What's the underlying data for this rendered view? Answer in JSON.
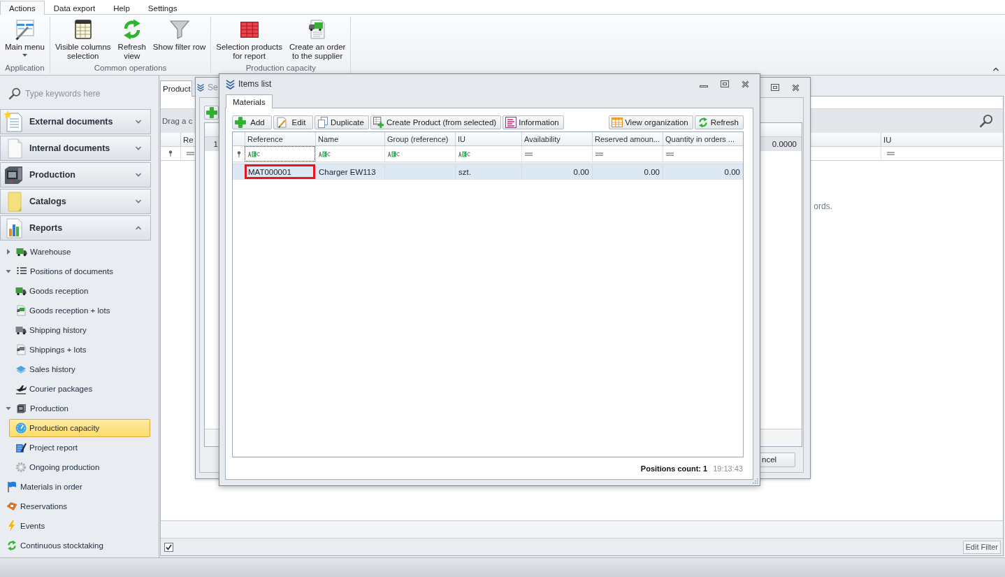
{
  "ribbon": {
    "tabs": [
      {
        "label": "Actions",
        "selected": true
      },
      {
        "label": "Data export",
        "selected": false
      },
      {
        "label": "Help",
        "selected": false
      },
      {
        "label": "Settings",
        "selected": false
      }
    ],
    "groups": [
      {
        "label": "Application",
        "buttons": [
          {
            "label": "Main menu",
            "dropdown": true
          }
        ]
      },
      {
        "label": "Common operations",
        "buttons": [
          {
            "label": "Visible columns\nselection",
            "dropdown": false
          },
          {
            "label": "Refresh\nview",
            "dropdown": false
          },
          {
            "label": "Show filter row",
            "dropdown": false
          }
        ]
      },
      {
        "label": "Production capacity",
        "buttons": [
          {
            "label": "Selection products\nfor report",
            "dropdown": false
          },
          {
            "label": "Create an order\nto the supplier",
            "dropdown": false
          }
        ]
      }
    ]
  },
  "sidebar": {
    "search": {
      "placeholder": "Type keywords here"
    },
    "groups": [
      {
        "label": "External documents",
        "expanded": false
      },
      {
        "label": "Internal documents",
        "expanded": false
      },
      {
        "label": "Production",
        "expanded": false
      },
      {
        "label": "Catalogs",
        "expanded": false
      },
      {
        "label": "Reports",
        "expanded": true
      }
    ],
    "tree": [
      {
        "label": "Warehouse",
        "expanded": false,
        "selected": false
      },
      {
        "label": "Positions of documents",
        "expanded": true,
        "selected": false,
        "children": [
          {
            "label": "Goods reception",
            "selected": false
          },
          {
            "label": "Goods reception + lots",
            "selected": false
          },
          {
            "label": "Shipping history",
            "selected": false
          },
          {
            "label": "Shippings + lots",
            "selected": false
          },
          {
            "label": "Sales history",
            "selected": false
          },
          {
            "label": "Courier packages",
            "selected": false
          }
        ]
      },
      {
        "label": "Production",
        "expanded": true,
        "selected": false,
        "children": [
          {
            "label": "Production capacity",
            "selected": true
          },
          {
            "label": "Project report",
            "selected": false
          },
          {
            "label": "Ongoing production",
            "selected": false
          }
        ]
      },
      {
        "label": "Materials in order",
        "selected": false
      },
      {
        "label": "Reservations",
        "selected": false
      },
      {
        "label": "Events",
        "selected": false
      },
      {
        "label": "Continuous stocktaking",
        "selected": false
      }
    ]
  },
  "main": {
    "tabs": [
      {
        "label": "Product",
        "selected": true
      }
    ],
    "group_panel": "Drag a c",
    "columns": [
      {
        "label": "Re"
      },
      {
        "label": "IU"
      }
    ],
    "empty_text": "ords.",
    "filter_bar": {
      "checked": true,
      "button": "Edit Filter"
    }
  },
  "back_dialog": {
    "title": "Se",
    "rows": [
      {
        "number": "1",
        "value": "0.0000"
      }
    ],
    "button": "ncel"
  },
  "items_dialog": {
    "title": "Items list",
    "tabs": [
      {
        "label": "Materials",
        "selected": true
      }
    ],
    "toolbar": {
      "left": [
        "Add",
        "Edit",
        "Duplicate",
        "Create Product (from selected)",
        "Information"
      ],
      "right": [
        "View organization",
        "Refresh"
      ]
    },
    "columns": [
      {
        "label": "Reference",
        "kind": "text",
        "filter_focused": true
      },
      {
        "label": "Name",
        "kind": "text",
        "filter_focused": false
      },
      {
        "label": "Group (reference)",
        "kind": "text",
        "filter_focused": false
      },
      {
        "label": "IU",
        "kind": "text",
        "filter_focused": false
      },
      {
        "label": "Availability",
        "kind": "number",
        "filter_focused": false
      },
      {
        "label": "Reserved amoun...",
        "kind": "number",
        "filter_focused": false
      },
      {
        "label": "Quantity in orders ...",
        "kind": "number",
        "filter_focused": false
      }
    ],
    "rows": [
      {
        "selected": true,
        "annotated": true,
        "cells": [
          "MAT000001",
          "Charger EW113",
          null,
          "szt.",
          "0.00",
          "0.00",
          "0.00"
        ]
      }
    ],
    "footer": {
      "count": "Positions count: 1",
      "time": "19:13:43"
    }
  }
}
